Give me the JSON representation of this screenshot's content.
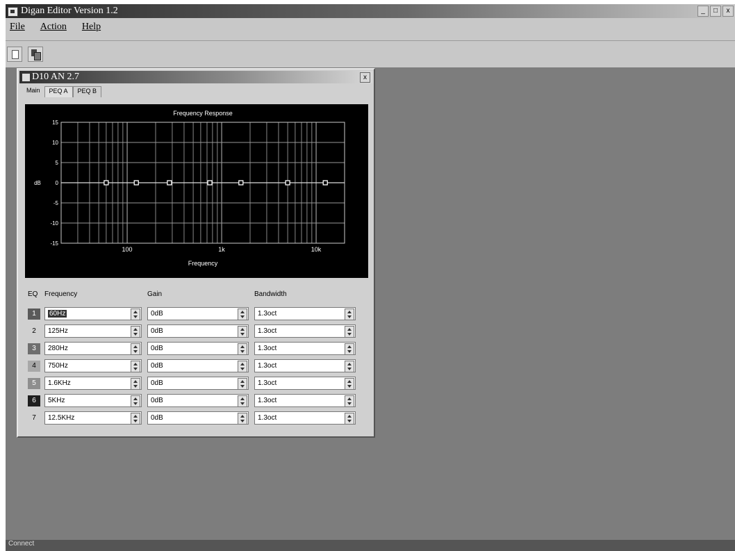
{
  "window": {
    "title": "Digan Editor Version 1.2",
    "controls": [
      "_",
      "□",
      "x"
    ]
  },
  "menu": {
    "file": "File",
    "action": "Action",
    "help": "Help"
  },
  "status": "Connect",
  "child": {
    "title": "D10 AN 2.7",
    "close": "x",
    "tabs": [
      "Main",
      "PEQ A",
      "PEQ B"
    ]
  },
  "graph": {
    "title": "Frequency Response",
    "ylabel": "dB",
    "xlabel": "Frequency",
    "y_ticks": [
      "15",
      "10",
      "5",
      "0",
      "-5",
      "-10",
      "-15"
    ],
    "x_ticks": [
      "100",
      "1k",
      "10k"
    ],
    "y_range": [
      -15,
      15
    ],
    "x_range_hz": [
      20,
      20000
    ]
  },
  "chart_data": {
    "type": "line",
    "title": "Frequency Response",
    "xlabel": "Frequency",
    "ylabel": "dB",
    "x_scale": "log",
    "xlim": [
      20,
      20000
    ],
    "ylim": [
      -15,
      15
    ],
    "grid": true,
    "points": [
      {
        "band": "1",
        "x": 60,
        "y": 0
      },
      {
        "band": "2",
        "x": 125,
        "y": 0
      },
      {
        "band": "3",
        "x": 280,
        "y": 0
      },
      {
        "band": "4",
        "x": 750,
        "y": 0
      },
      {
        "band": "5",
        "x": 1600,
        "y": 0
      },
      {
        "band": "6",
        "x": 5000,
        "y": 0
      },
      {
        "band": "7",
        "x": 12500,
        "y": 0
      }
    ]
  },
  "eq": {
    "headers": {
      "band": "EQ",
      "frequency": "Frequency",
      "gain": "Gain",
      "bandwidth": "Bandwidth"
    },
    "bands": [
      {
        "num": "1",
        "freq": "60Hz",
        "gain": "0dB",
        "bw": "1.3oct",
        "color": "#5a5a5a",
        "selected": true
      },
      {
        "num": "2",
        "freq": "125Hz",
        "gain": "0dB",
        "bw": "1.3oct",
        "color": "#d0d0d0",
        "selected": false
      },
      {
        "num": "3",
        "freq": "280Hz",
        "gain": "0dB",
        "bw": "1.3oct",
        "color": "#6e6e6e",
        "selected": false
      },
      {
        "num": "4",
        "freq": "750Hz",
        "gain": "0dB",
        "bw": "1.3oct",
        "color": "#a8a8a8",
        "selected": false
      },
      {
        "num": "5",
        "freq": "1.6KHz",
        "gain": "0dB",
        "bw": "1.3oct",
        "color": "#8e8e8e",
        "selected": false
      },
      {
        "num": "6",
        "freq": "5KHz",
        "gain": "0dB",
        "bw": "1.3oct",
        "color": "#1e1e1e",
        "selected": false
      },
      {
        "num": "7",
        "freq": "12.5KHz",
        "gain": "0dB",
        "bw": "1.3oct",
        "color": "#d0d0d0",
        "selected": false
      }
    ]
  }
}
